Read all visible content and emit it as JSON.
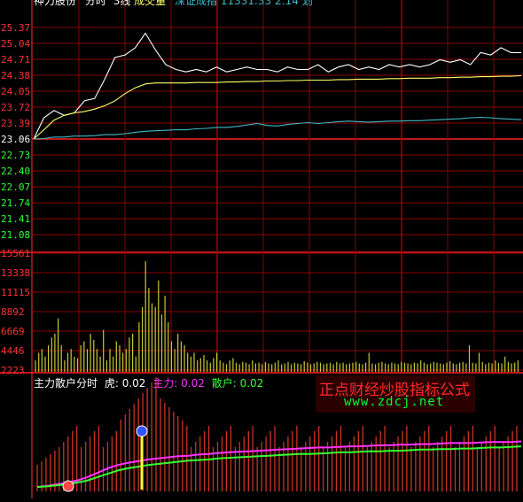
{
  "header": {
    "title": "神力股份",
    "view": "分时",
    "mode": "3线",
    "volume_label": "成交量",
    "index": "深证成指",
    "index_value": "11331.33",
    "time": "2:14",
    "suffix": "划"
  },
  "price_axis": {
    "ticks": [
      "25.37",
      "25.04",
      "24.71",
      "24.38",
      "24.05",
      "23.72",
      "23.39",
      "23.06",
      "22.73",
      "22.40",
      "22.07",
      "21.74",
      "21.41",
      "21.08"
    ],
    "prev_close": "23.06"
  },
  "volume_axis": {
    "ticks": [
      "15561",
      "13338",
      "11115",
      "8892",
      "6669",
      "4446",
      "2223"
    ]
  },
  "indicator": {
    "name": "主力散户分时",
    "tiger_label": "虎:",
    "tiger_value": "0.02",
    "main_label": "主力:",
    "main_value": "0.02",
    "retail_label": "散户:",
    "retail_value": "0.02"
  },
  "watermark": {
    "line1": "正点财经炒股指标公式",
    "line2": "www.zdcj.net"
  },
  "colors": {
    "price_line": "#ffffff",
    "avg_line": "#ffff66",
    "index_line": "#3fb9c8",
    "volume_bar": "#c8c832",
    "grid": "#8b0000",
    "axis_red": "#ff3333",
    "axis_green": "#33ff33",
    "main_line": "#ff33ff",
    "retail_line": "#33ff33",
    "ind_bar": "#cc3322"
  },
  "chart_data": [
    {
      "type": "line",
      "name": "price",
      "ylim": [
        21.08,
        25.37
      ],
      "x": [
        0,
        5,
        10,
        15,
        20,
        25,
        30,
        35,
        40,
        45,
        50,
        55,
        60,
        65,
        70,
        75,
        80,
        85,
        90,
        95,
        100,
        105,
        110,
        115,
        120,
        125,
        130,
        135,
        140,
        145,
        150,
        155,
        160,
        165,
        170,
        175,
        180,
        185,
        190,
        195,
        200,
        205,
        210,
        215,
        220,
        225,
        230,
        235,
        240
      ],
      "series": [
        {
          "name": "price",
          "values": [
            23.06,
            23.5,
            23.65,
            23.55,
            23.6,
            23.85,
            23.9,
            24.3,
            24.75,
            24.8,
            24.95,
            25.25,
            24.9,
            24.6,
            24.5,
            24.45,
            24.5,
            24.45,
            24.55,
            24.45,
            24.5,
            24.55,
            24.5,
            24.5,
            24.45,
            24.55,
            24.5,
            24.5,
            24.6,
            24.45,
            24.55,
            24.6,
            24.5,
            24.55,
            24.5,
            24.6,
            24.55,
            24.6,
            24.55,
            24.6,
            24.7,
            24.65,
            24.7,
            24.6,
            24.85,
            24.8,
            24.95,
            24.85,
            24.85
          ]
        },
        {
          "name": "avg",
          "values": [
            23.06,
            23.25,
            23.45,
            23.55,
            23.6,
            23.63,
            23.68,
            23.75,
            23.85,
            24.0,
            24.12,
            24.2,
            24.22,
            24.22,
            24.22,
            24.22,
            24.23,
            24.23,
            24.23,
            24.24,
            24.24,
            24.25,
            24.25,
            24.26,
            24.26,
            24.27,
            24.27,
            24.28,
            24.28,
            24.28,
            24.29,
            24.29,
            24.3,
            24.3,
            24.3,
            24.31,
            24.31,
            24.32,
            24.32,
            24.32,
            24.33,
            24.33,
            24.34,
            24.34,
            24.35,
            24.35,
            24.36,
            24.36,
            24.37
          ]
        },
        {
          "name": "index",
          "values": [
            23.06,
            23.07,
            23.1,
            23.1,
            23.12,
            23.12,
            23.13,
            23.15,
            23.15,
            23.17,
            23.2,
            23.22,
            23.23,
            23.24,
            23.25,
            23.25,
            23.27,
            23.28,
            23.3,
            23.3,
            23.32,
            23.35,
            23.38,
            23.34,
            23.33,
            23.36,
            23.38,
            23.4,
            23.38,
            23.4,
            23.42,
            23.43,
            23.42,
            23.41,
            23.42,
            23.43,
            23.43,
            23.44,
            23.44,
            23.45,
            23.46,
            23.47,
            23.48,
            23.5,
            23.51,
            23.5,
            23.48,
            23.47,
            23.46
          ]
        }
      ]
    },
    {
      "type": "bar",
      "name": "volume",
      "ylim": [
        0,
        15561
      ],
      "values": [
        1500,
        2500,
        3000,
        2000,
        3500,
        4500,
        5000,
        7000,
        3500,
        1500,
        2500,
        3000,
        2000,
        1800,
        3500,
        4000,
        3000,
        5000,
        4200,
        3000,
        2000,
        5500,
        1500,
        3000,
        2000,
        4000,
        3500,
        2500,
        3000,
        4500,
        5000,
        2000,
        6500,
        8500,
        14500,
        11000,
        9000,
        8500,
        12000,
        7500,
        10000,
        6500,
        4000,
        3000,
        5000,
        4000,
        3500,
        2500,
        2000,
        2500,
        1500,
        1800,
        2200,
        1500,
        1200,
        1800,
        2500,
        1500,
        1200,
        1000,
        1500,
        1800,
        1200,
        1000,
        1300,
        1200,
        1000,
        1500,
        1100,
        1200,
        1000,
        1300,
        1100,
        1000,
        1200,
        1500,
        1000,
        1100,
        1300,
        1000,
        1200,
        1100,
        1000,
        1400,
        1200,
        1000,
        1100,
        1300,
        1200,
        1000,
        1100,
        1200,
        1000,
        1300,
        1100,
        1200,
        1000,
        1100,
        1200,
        1300,
        1100,
        1000,
        1200,
        2500,
        1100,
        1000,
        1200,
        1300,
        1100,
        1000,
        1200,
        1100,
        1000,
        1300,
        1200,
        1100,
        1000,
        1200,
        1100,
        1500,
        1200,
        1000,
        1100,
        1300,
        1200,
        1100,
        1000,
        1200,
        1400,
        1100,
        1000,
        1200,
        1300,
        1100,
        3500,
        1200,
        1100,
        2500,
        1300,
        1000,
        1200,
        1100,
        1500,
        1200,
        1100,
        2000,
        1300,
        1100,
        1200,
        1500
      ]
    },
    {
      "type": "line",
      "name": "main-retail",
      "series": [
        {
          "name": "主力",
          "values": [
            0,
            0.02,
            0.05,
            0.08,
            0.12,
            0.18,
            0.26,
            0.34,
            0.4,
            0.44,
            0.47,
            0.5,
            0.52,
            0.54,
            0.56,
            0.57,
            0.59,
            0.6,
            0.62,
            0.63,
            0.64,
            0.65,
            0.66,
            0.67,
            0.68,
            0.69,
            0.7,
            0.71,
            0.72,
            0.72,
            0.73,
            0.74,
            0.74,
            0.75,
            0.76,
            0.76,
            0.77,
            0.77,
            0.78,
            0.78,
            0.79,
            0.8,
            0.8,
            0.8,
            0.81,
            0.82,
            0.82,
            0.82,
            0.83
          ]
        },
        {
          "name": "散户",
          "values": [
            0,
            0.01,
            0.03,
            0.05,
            0.08,
            0.12,
            0.18,
            0.24,
            0.3,
            0.34,
            0.37,
            0.4,
            0.42,
            0.44,
            0.46,
            0.48,
            0.49,
            0.5,
            0.52,
            0.53,
            0.54,
            0.55,
            0.56,
            0.57,
            0.58,
            0.59,
            0.6,
            0.6,
            0.61,
            0.62,
            0.63,
            0.63,
            0.64,
            0.65,
            0.65,
            0.66,
            0.66,
            0.67,
            0.68,
            0.68,
            0.69,
            0.69,
            0.7,
            0.7,
            0.71,
            0.72,
            0.72,
            0.73,
            0.74
          ]
        }
      ]
    }
  ]
}
